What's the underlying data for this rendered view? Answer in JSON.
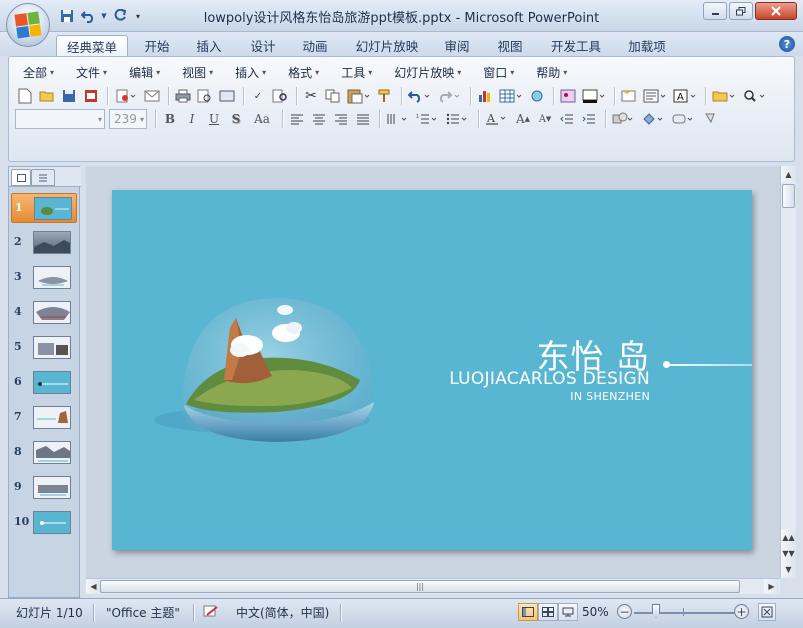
{
  "window": {
    "title": "lowpoly设计风格东怡岛旅游ppt模板.pptx - Microsoft PowerPoint",
    "controls": [
      "minimize",
      "restore",
      "close"
    ]
  },
  "quick_access": [
    "save-icon",
    "undo-icon",
    "redo-icon",
    "customize-icon"
  ],
  "tabs": [
    {
      "label": "经典菜单",
      "active": true
    },
    {
      "label": "开始"
    },
    {
      "label": "插入"
    },
    {
      "label": "设计"
    },
    {
      "label": "动画"
    },
    {
      "label": "幻灯片放映"
    },
    {
      "label": "审阅"
    },
    {
      "label": "视图"
    },
    {
      "label": "开发工具"
    },
    {
      "label": "加载项"
    }
  ],
  "menus": [
    "全部",
    "文件",
    "编辑",
    "视图",
    "插入",
    "格式",
    "工具",
    "幻灯片放映",
    "窗口",
    "帮助"
  ],
  "font_size_value": "239",
  "slides": {
    "numbers": [
      "1",
      "2",
      "3",
      "4",
      "5",
      "6",
      "7",
      "8",
      "9",
      "10"
    ],
    "selected": 1
  },
  "slide": {
    "title": "东怡 岛",
    "subtitle": "LUOJIACARLOS DESIGN",
    "subtitle2": "IN SHENZHEN",
    "background": "#58b6d3"
  },
  "status": {
    "slide_indicator": "幻灯片 1/10",
    "theme": "\"Office 主题\"",
    "language": "中文(简体，中国)",
    "zoom": "50%"
  },
  "colors": {
    "accent_selected": "#e38d35",
    "slide_bg": "#58b6d3"
  }
}
